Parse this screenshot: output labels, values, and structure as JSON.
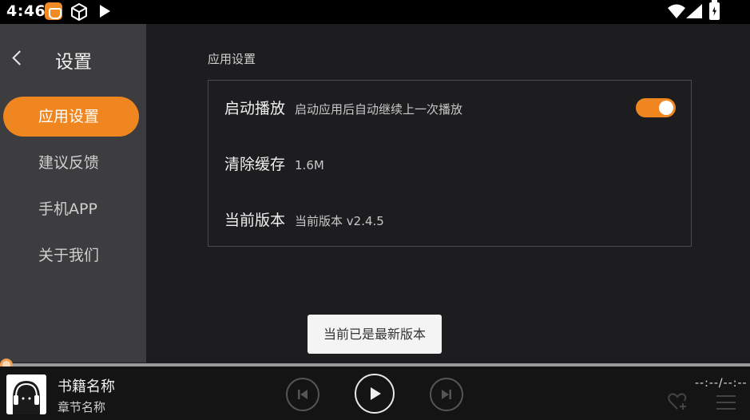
{
  "status_bar": {
    "time": "4:46",
    "icons": [
      "app-notification-icon",
      "cube-icon",
      "play-icon",
      "wifi-icon",
      "cell-signal-icon",
      "battery-charging-icon"
    ]
  },
  "sidebar": {
    "back_icon": "chevron-left-icon",
    "title": "设置",
    "items": [
      {
        "label": "应用设置",
        "active": true
      },
      {
        "label": "建议反馈",
        "active": false
      },
      {
        "label": "手机APP",
        "active": false
      },
      {
        "label": "关于我们",
        "active": false
      }
    ]
  },
  "main": {
    "section_title": "应用设置",
    "rows": [
      {
        "name": "启动播放",
        "desc": "启动应用后自动继续上一次播放",
        "toggle_on": true
      },
      {
        "name": "清除缓存",
        "desc": "1.6M"
      },
      {
        "name": "当前版本",
        "desc": "当前版本 v2.4.5"
      }
    ]
  },
  "toast": {
    "text": "当前已是最新版本"
  },
  "player": {
    "book_name": "书籍名称",
    "chapter_name": "章节名称",
    "time": "--:--/--:--",
    "progress": 0,
    "icons": [
      "skip-previous-icon",
      "play-icon",
      "skip-next-icon",
      "favorite-add-icon",
      "playlist-icon"
    ]
  },
  "colors": {
    "accent": "#f0861f",
    "background": "#1d1d1f",
    "sidebar": "#3d3d3f",
    "player_bar": "#141414"
  }
}
